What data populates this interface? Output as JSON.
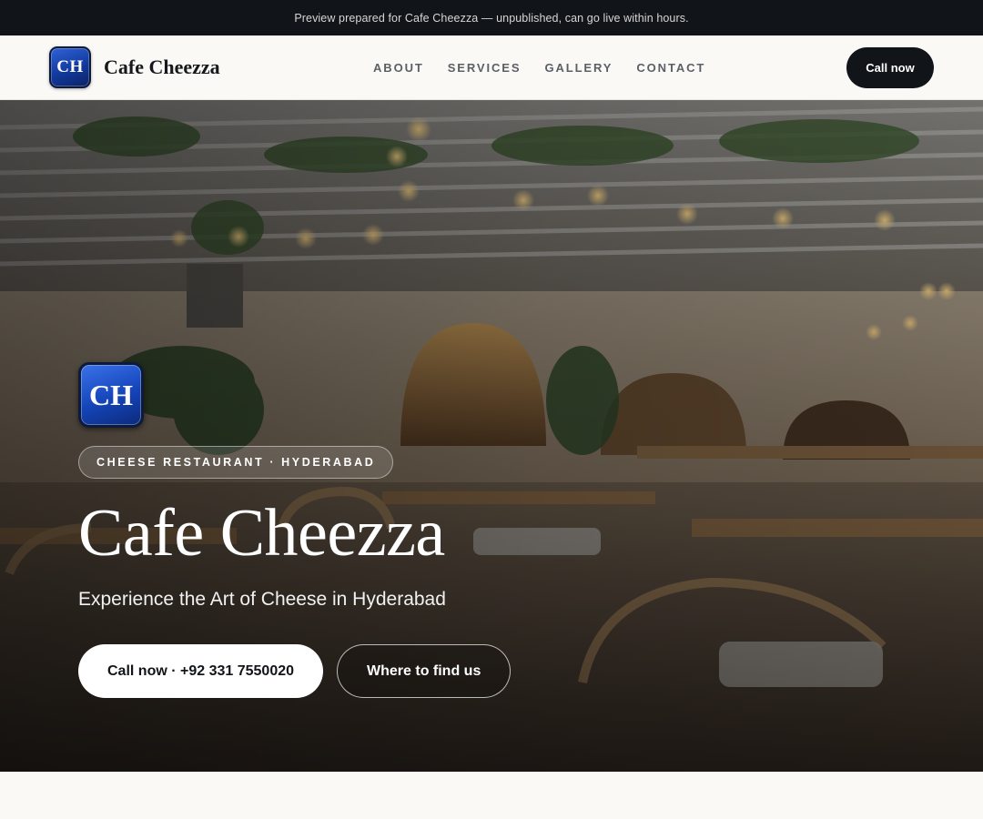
{
  "banner": {
    "text": "Preview prepared for Cafe Cheezza — unpublished, can go live within hours."
  },
  "nav": {
    "logo_initials": "CH",
    "brand_name": "Cafe Cheezza",
    "links": [
      "ABOUT",
      "SERVICES",
      "GALLERY",
      "CONTACT"
    ],
    "call_label": "Call now"
  },
  "hero": {
    "logo_initials": "CH",
    "tagline": "CHEESE RESTAURANT · HYDERABAD",
    "title": "Cafe Cheezza",
    "subtitle": "Experience the Art of Cheese in Hyderabad",
    "primary_cta": "Call now · +92 331 7550020",
    "secondary_cta": "Where to find us",
    "background_image": "restaurant-interior-photo"
  },
  "colors": {
    "dark": "#111418",
    "logo_blue": "#1544b8",
    "page_bg": "#faf9f6"
  }
}
